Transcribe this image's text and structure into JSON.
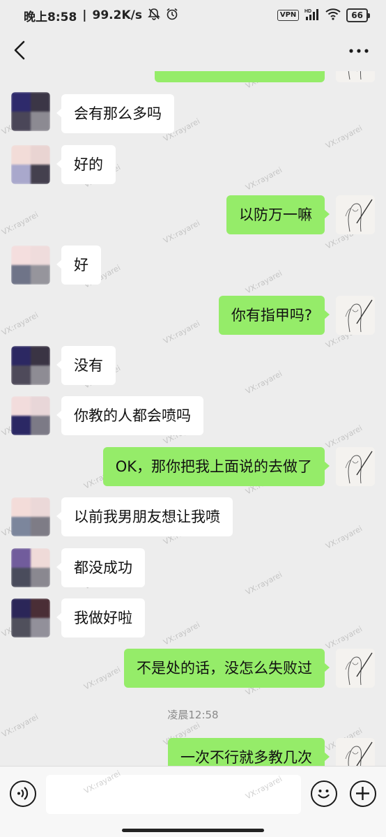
{
  "status_bar": {
    "time": "晚上8:58",
    "speed": "99.2K/s",
    "vpn": "VPN",
    "hd": "HD",
    "battery": "66",
    "icons": [
      "mute-icon",
      "alarm-icon",
      "signal-icon",
      "wifi-icon",
      "battery-icon"
    ]
  },
  "nav": {
    "back_icon": "chevron-left-icon",
    "more_icon": "more-dots-icon"
  },
  "watermark_text": "VX:rayarei",
  "messages": [
    {
      "side": "out",
      "text": ""
    },
    {
      "side": "in",
      "text": "会有那么多吗"
    },
    {
      "side": "in",
      "text": "好的"
    },
    {
      "side": "out",
      "text": "以防万一嘛"
    },
    {
      "side": "in",
      "text": "好"
    },
    {
      "side": "out",
      "text": "你有指甲吗?"
    },
    {
      "side": "in",
      "text": "没有"
    },
    {
      "side": "in",
      "text": "你教的人都会喷吗"
    },
    {
      "side": "out",
      "text": "OK，那你把我上面说的去做了"
    },
    {
      "side": "in",
      "text": "以前我男朋友想让我喷"
    },
    {
      "side": "in",
      "text": "都没成功"
    },
    {
      "side": "in",
      "text": "我做好啦"
    },
    {
      "side": "out",
      "text": "不是处的话，没怎么失败过"
    },
    {
      "side": "out",
      "text": "一次不行就多教几次"
    }
  ],
  "timestamp": "凌晨12:58",
  "input": {
    "value": "",
    "voice_icon": "voice-icon",
    "emoji_icon": "emoji-icon",
    "plus_icon": "plus-icon"
  },
  "colors": {
    "background": "#ededed",
    "outgoing_bubble": "#95ec69",
    "incoming_bubble": "#ffffff"
  }
}
